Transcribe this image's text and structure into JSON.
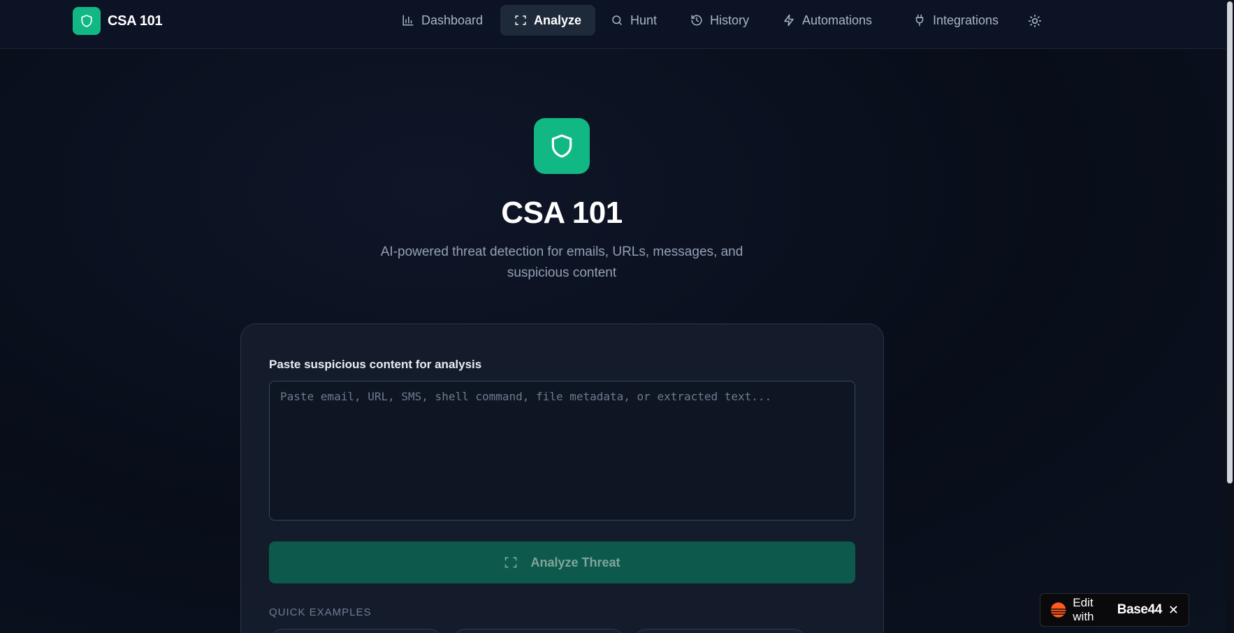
{
  "brand": {
    "name": "CSA 101",
    "icon": "shield-icon"
  },
  "nav": {
    "items": [
      {
        "label": "Dashboard",
        "icon": "bar-chart-icon"
      },
      {
        "label": "Analyze",
        "icon": "scan-icon",
        "active": true
      },
      {
        "label": "Hunt",
        "icon": "search-icon"
      },
      {
        "label": "History",
        "icon": "history-icon"
      },
      {
        "label": "Automations",
        "icon": "lightning-icon"
      },
      {
        "label": "Integrations",
        "icon": "plug-icon"
      }
    ],
    "theme_toggle_icon": "sun-icon"
  },
  "hero": {
    "title": "CSA 101",
    "subtitle": "AI-powered threat detection for emails, URLs, messages, and suspicious content"
  },
  "analysis": {
    "label": "Paste suspicious content for analysis",
    "placeholder": "Paste email, URL, SMS, shell command, file metadata, or extracted text...",
    "value": "",
    "button_label": "Analyze Threat",
    "quick_examples_label": "QUICK EXAMPLES"
  },
  "badge": {
    "edit_text": "Edit with",
    "brand": "Base44"
  },
  "colors": {
    "accent": "#12b884",
    "button_disabled": "#0d5a4c",
    "background": "#0a101d",
    "card": "#141c2c",
    "badge_orange": "#ff5a1f"
  }
}
